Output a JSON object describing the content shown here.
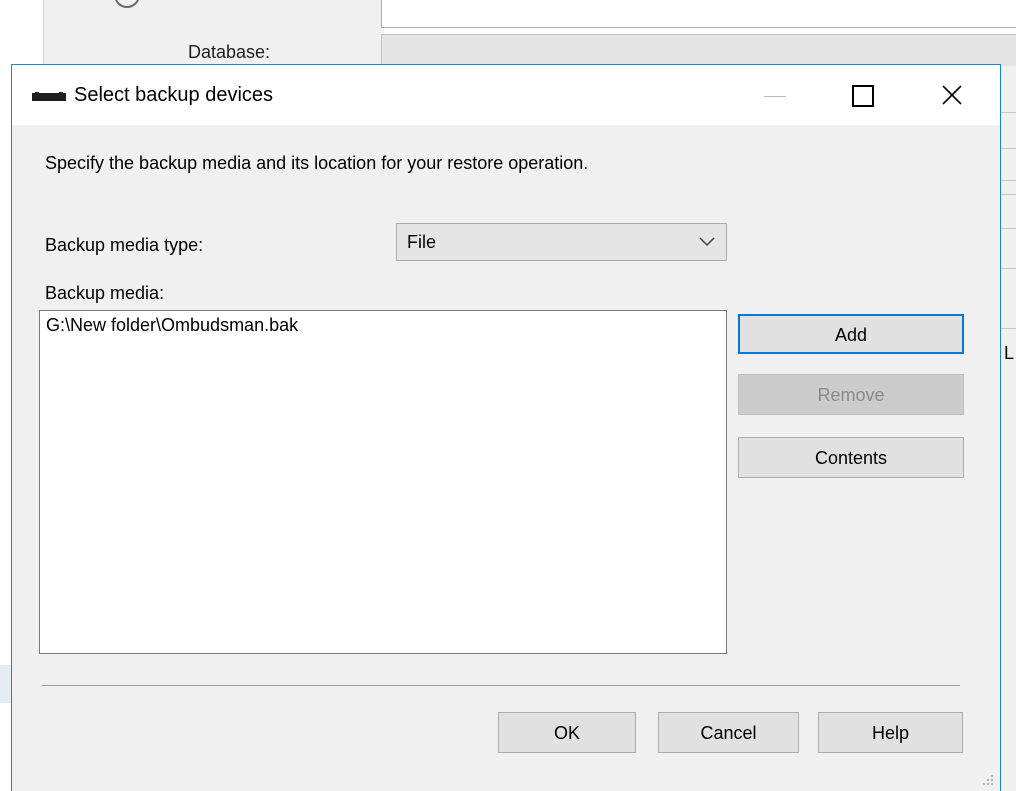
{
  "background": {
    "database_label": "Database:",
    "right_edge_text": "L"
  },
  "dialog": {
    "title": "Select backup devices",
    "title_icon": "tape-drive-icon",
    "window_controls": {
      "minimize_icon": "minimize-icon",
      "maximize_icon": "maximize-icon",
      "close_glyph": "✕"
    },
    "instructions": "Specify the backup media and its location for your restore operation.",
    "backup_media_type": {
      "label": "Backup media type:",
      "selected": "File"
    },
    "backup_media": {
      "label": "Backup media:",
      "items": [
        "G:\\New folder\\Ombudsman.bak"
      ]
    },
    "side_buttons": {
      "add": "Add",
      "remove": "Remove",
      "contents": "Contents"
    },
    "footer_buttons": {
      "ok": "OK",
      "cancel": "Cancel",
      "help": "Help"
    },
    "colors": {
      "accent": "#0078d7",
      "dialog_border": "#1883d7",
      "dialog_background": "#f0f0f0",
      "disabled_text": "#8a8a8a"
    }
  }
}
